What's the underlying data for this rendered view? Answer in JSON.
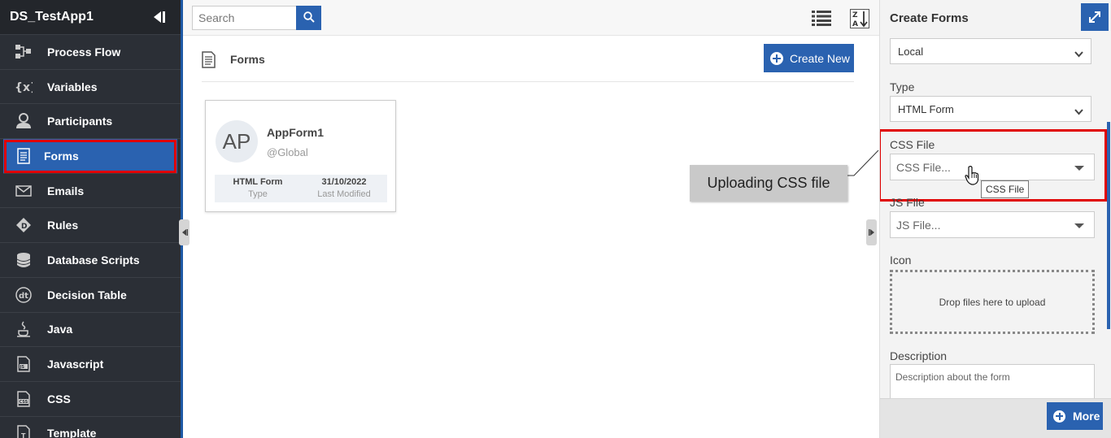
{
  "app": {
    "title": "DS_TestApp1"
  },
  "sidebar": {
    "items": [
      {
        "label": "Process Flow",
        "icon": "process-flow-icon"
      },
      {
        "label": "Variables",
        "icon": "variables-icon"
      },
      {
        "label": "Participants",
        "icon": "participant-icon"
      },
      {
        "label": "Forms",
        "icon": "form-icon",
        "active": true
      },
      {
        "label": "Emails",
        "icon": "email-icon"
      },
      {
        "label": "Rules",
        "icon": "rules-icon"
      },
      {
        "label": "Database Scripts",
        "icon": "database-icon"
      },
      {
        "label": "Decision Table",
        "icon": "decision-table-icon"
      },
      {
        "label": "Java",
        "icon": "java-icon"
      },
      {
        "label": "Javascript",
        "icon": "javascript-icon"
      },
      {
        "label": "CSS",
        "icon": "css-icon"
      },
      {
        "label": "Template",
        "icon": "template-icon"
      }
    ]
  },
  "toolbar": {
    "search_placeholder": "Search"
  },
  "page": {
    "title": "Forms",
    "create_label": "Create New"
  },
  "card": {
    "avatar": "AP",
    "name": "AppForm1",
    "scope": "@Global",
    "type_value": "HTML Form",
    "type_label": "Type",
    "modified_value": "31/10/2022",
    "modified_label": "Last Modified"
  },
  "callout": {
    "text": "Uploading CSS file"
  },
  "panel": {
    "title": "Create Forms",
    "scope_value": "Local",
    "type_label": "Type",
    "type_value": "HTML Form",
    "css_label": "CSS File",
    "css_placeholder": "CSS File...",
    "css_tooltip": "CSS File",
    "js_label": "JS File",
    "js_placeholder": "JS File...",
    "icon_label": "Icon",
    "dropzone_text": "Drop files here to upload",
    "description_label": "Description",
    "description_placeholder": "Description about the form",
    "more_label": "More"
  },
  "colors": {
    "accent": "#2a62b0",
    "sidebar_bg": "#2b2f36",
    "highlight": "#e00000"
  }
}
